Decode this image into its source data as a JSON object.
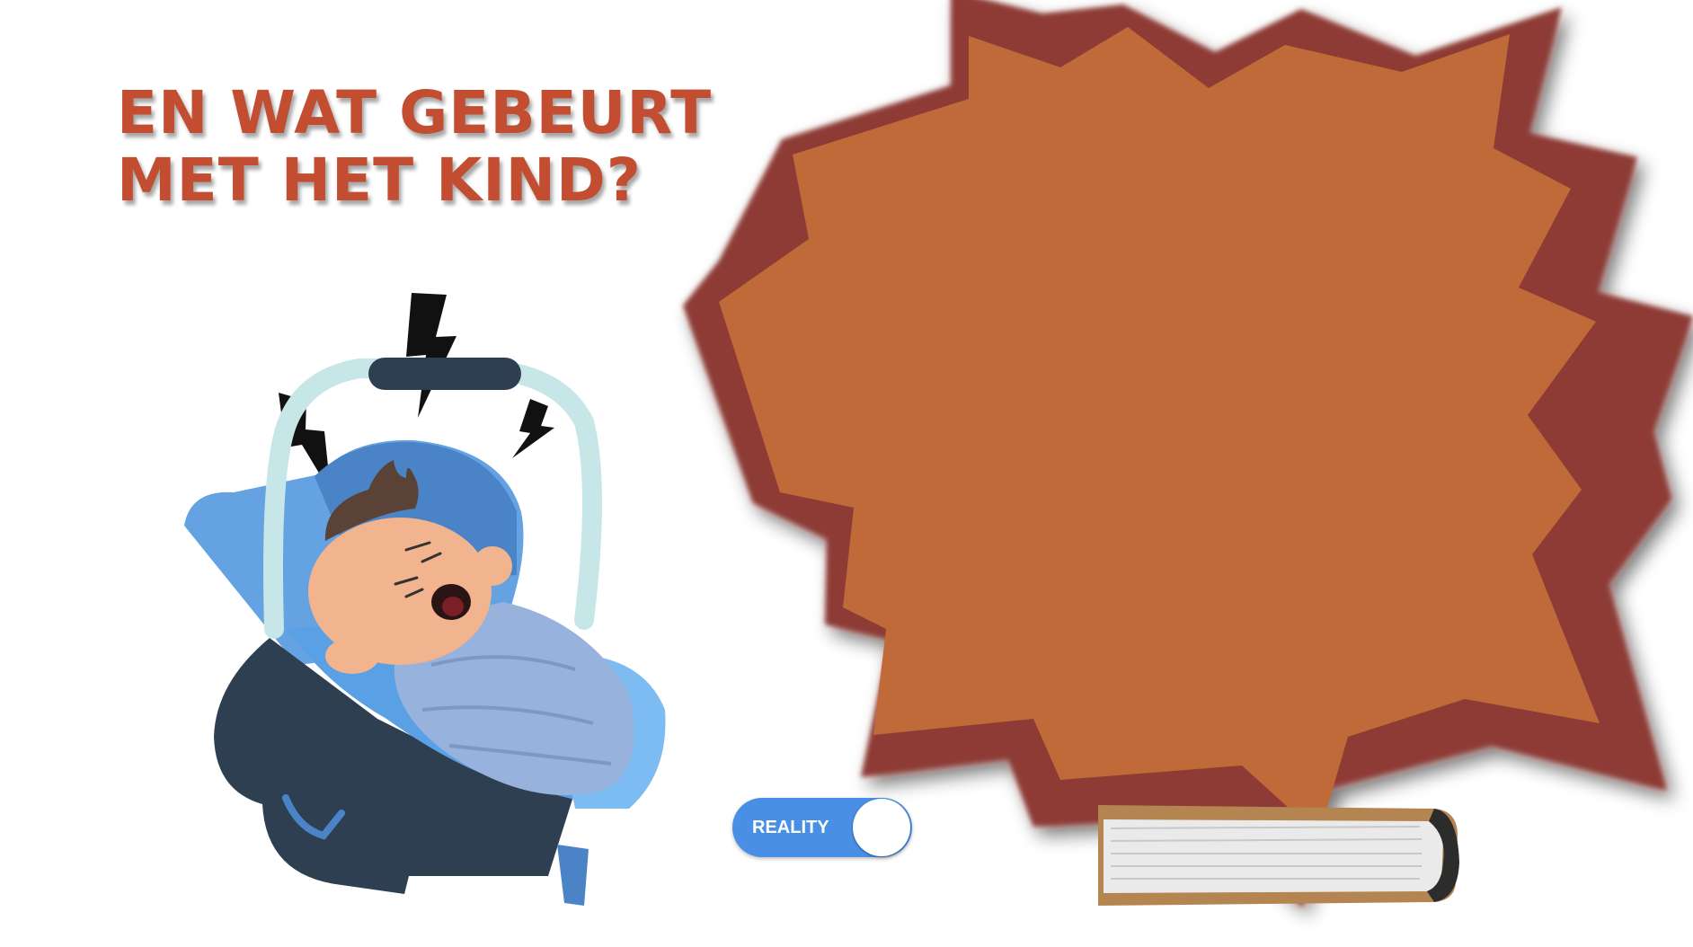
{
  "headline": {
    "line1": "EN WAT GEBEURT",
    "line2": "MET HET KIND?"
  },
  "toggle": {
    "label": "REALITY",
    "state": "on"
  },
  "icons": {
    "burst": "speech-burst",
    "baby": "crying-baby-in-car-seat",
    "lightning": "lightning-bolt-icon",
    "book": "closed-book-icon"
  },
  "colors": {
    "headline": "#c24d30",
    "burst_fill": "#bf6a39",
    "burst_outline": "#8e3a34",
    "toggle": "#4a8fe6"
  }
}
